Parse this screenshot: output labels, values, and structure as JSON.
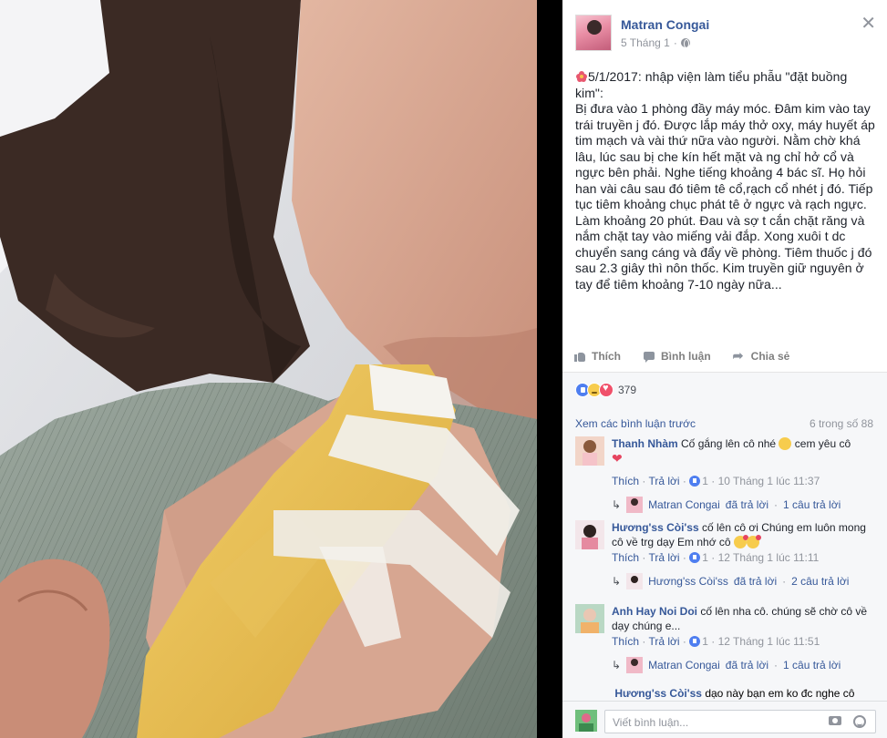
{
  "post": {
    "author": "Matran Congai",
    "date": "5 Tháng 1",
    "privacy_icon": "globe-icon",
    "text_intro": "5/1/2017: nhập viện làm tiểu phẫu \"đặt buồng kim\":",
    "text_body": "Bị đưa vào 1 phòng đầy máy móc. Đâm kim vào tay trái truyền j đó. Được lắp máy thở oxy, máy huyết áp tim mạch và vài thứ nữa vào người. Nằm chờ khá lâu, lúc sau bị che kín hết mặt và ng chỉ hở cổ và ngực bên phải. Nghe tiếng khoảng 4 bác sĩ. Họ hỏi han vài câu sau đó tiêm tê cổ,rạch cổ nhét j đó. Tiếp tục tiêm khoảng chục phát tê ở ngực và rạch ngực. Làm khoảng 20 phút. Đau và sợ t cắn chặt răng và nắm chặt tay vào miếng vải đắp. Xong xuôi t dc chuyển sang cáng và đẩy về phòng. Tiêm thuốc j đó sau 2.3 giây thì nôn thốc. Kim truyền giữ nguyên ở tay để tiêm khoảng 7-10 ngày nữa..."
  },
  "actions": {
    "like": "Thích",
    "comment": "Bình luận",
    "share": "Chia sẻ"
  },
  "reactions": {
    "count": "379",
    "types": [
      "like",
      "sad",
      "love"
    ]
  },
  "comments_header": {
    "view_previous": "Xem các bình luận trước",
    "count_of": "6 trong số 88"
  },
  "comments": [
    {
      "name": "Thanh Nhàm",
      "text": "Cố gắng lên cô nhé",
      "text_after": "cem yêu cô",
      "like": "Thích",
      "reply": "Trả lời",
      "likes": "1",
      "time": "10 Tháng 1 lúc 11:37",
      "reply_author": "Matran Congai",
      "reply_action": "đã trả lời",
      "reply_count": "1 câu trả lời"
    },
    {
      "name": "Hương'ss Còi'ss",
      "text": "cố lên cô ơi Chúng em luôn mong cô về trg dạy Em nhớ cô",
      "like": "Thích",
      "reply": "Trả lời",
      "likes": "1",
      "time": "12 Tháng 1 lúc 11:11",
      "reply_author": "Hương'ss Còi'ss",
      "reply_action": "đã trả lời",
      "reply_count": "2 câu trả lời"
    },
    {
      "name": "Anh Hay Noi Doi",
      "text": "cố lên nha cô. chúng sẽ chờ cô về dạy chúng e...",
      "like": "Thích",
      "reply": "Trả lời",
      "likes": "1",
      "time": "12 Tháng 1 lúc 11:51",
      "reply_author": "Matran Congai",
      "reply_action": "đã trả lời",
      "reply_count": "1 câu trả lời"
    }
  ],
  "cutoff_comment": {
    "name": "Hương'ss Còi'ss",
    "text": "dạo này bạn em ko đc nghe cô"
  },
  "compose": {
    "placeholder": "Viết bình luận..."
  },
  "colors": {
    "link": "#365899",
    "text": "#1d2129",
    "muted": "#90949c",
    "panel_bg": "#ffffff",
    "comments_bg": "#f6f7f9"
  }
}
